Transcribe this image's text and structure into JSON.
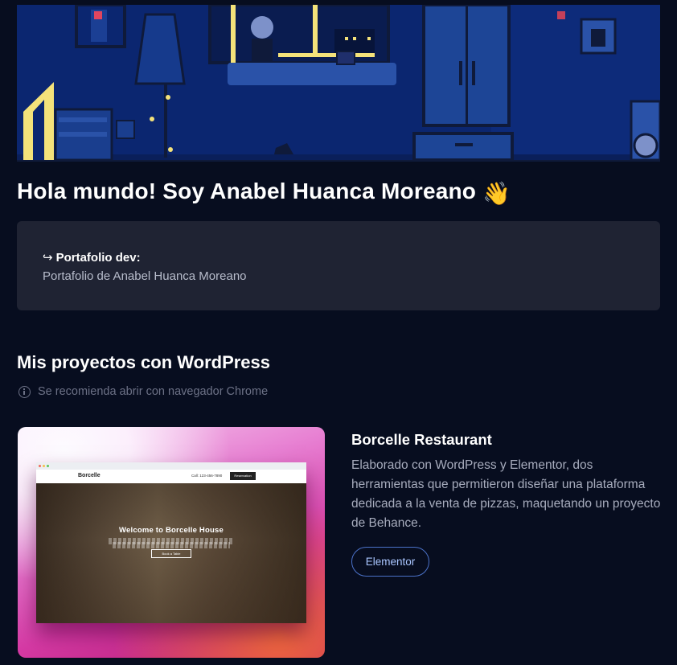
{
  "hero": {
    "icon": "pixel-art-room-illustration"
  },
  "header": {
    "title": "Hola mundo! Soy Anabel Huanca Moreano",
    "emoji": "👋"
  },
  "portfolio_card": {
    "arrow": "↪",
    "label": "Portafolio dev:",
    "description": "Portafolio de Anabel Huanca Moreano"
  },
  "projects_section": {
    "title": "Mis proyectos con WordPress",
    "note": "Se recomienda abrir con navegador Chrome",
    "items": [
      {
        "title": "Borcelle Restaurant",
        "description": "Elaborado con WordPress y Elementor, dos herramientas que permitieron diseñar una plataforma dedicada a la venta de pizzas, maquetando un proyecto de Behance.",
        "tag": "Elementor",
        "preview": {
          "brand": "Borcelle",
          "call": "Call: 123-456-7890",
          "nav_button": "Reservation",
          "headline": "Welcome to Borcelle House",
          "cta": "Book a Table"
        }
      }
    ]
  },
  "colors": {
    "background": "#070d1f",
    "card": "#1f2333",
    "accent": "#4b72c9",
    "hero": "#0b2670"
  }
}
